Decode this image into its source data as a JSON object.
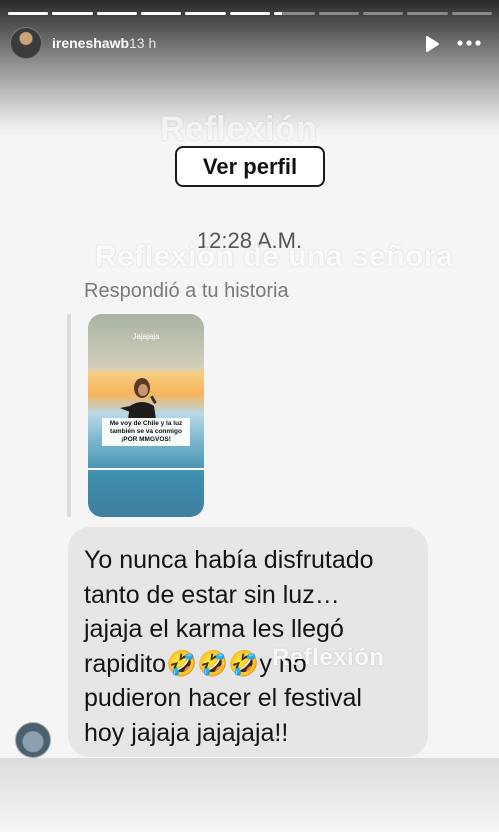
{
  "story": {
    "progress_segments": [
      1,
      1,
      1,
      1,
      1,
      1,
      0.2,
      0,
      0,
      0,
      0
    ],
    "username": "ireneshawb",
    "time_ago": "13 h"
  },
  "watermark": {
    "top": "Reflexión",
    "middle": "Reflexión de una señora",
    "bottom": "Reflexión"
  },
  "dm": {
    "view_profile_label": "Ver perfil",
    "timestamp": "12:28 A.M.",
    "reply_note": "Respondió a tu historia",
    "thumbnail": {
      "label": "Jajajaja",
      "caption": "Me voy de Chile y la luz también se va conmigo ¡POR MMGVOS!"
    },
    "message_lines": [
      "Yo nunca había disfrutado",
      "tanto de estar sin luz…",
      "jajaja el karma les llegó",
      "rapidito🤣🤣🤣y no",
      "pudieron hacer el festival",
      "hoy jajaja jajajaja!!"
    ]
  },
  "icons": {
    "play": "play-icon",
    "more": "more-horizontal-icon"
  }
}
